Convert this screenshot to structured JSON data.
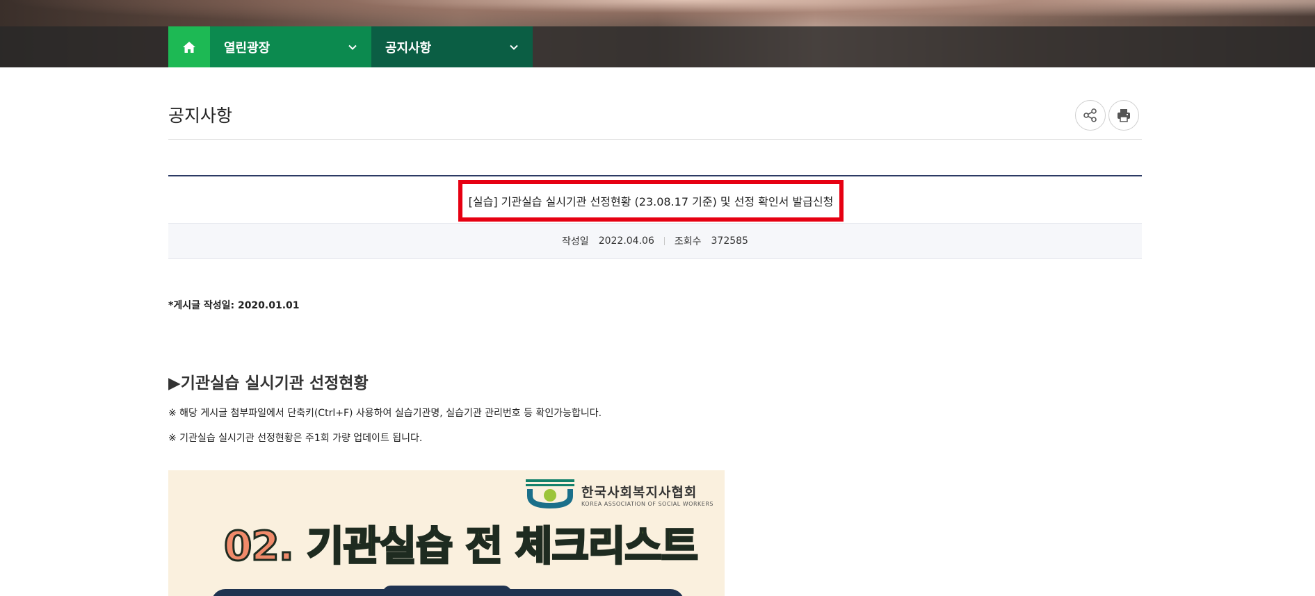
{
  "breadcrumb": {
    "home_icon": "home-icon",
    "level1": "열린광장",
    "level2": "공지사항",
    "chevron_icon": "chevron-down-icon"
  },
  "page": {
    "title": "공지사항",
    "share_icon": "share-icon",
    "print_icon": "print-icon"
  },
  "post": {
    "title": "[실습] 기관실습 실시기관 선정현황 (23.08.17 기준) 및 선정 확인서 발급신청",
    "date_label": "작성일",
    "date_value": "2022.04.06",
    "views_label": "조회수",
    "views_value": "372585"
  },
  "content": {
    "written_note": "*게시글 작성일: 2020.01.01",
    "section_heading": "▶기관실습 실시기관 선정현황",
    "note1": "※ 해당 게시글 첨부파일에서 단축키(Ctrl+F) 사용하여 실습기관명, 실습기관 관리번호 등 확인가능합니다.",
    "note2": "※ 기관실습 실시기관 선정현황은 주1회 가량 업데이트 됩니다."
  },
  "banner": {
    "logo_ko": "한국사회복지사협회",
    "logo_en": "KOREA ASSOCIATION OF SOCIAL WORKERS",
    "title_number": "02.",
    "title_text": "기관실습 전 체크리스트"
  },
  "colors": {
    "home_green": "#1db954",
    "crumb1": "#0c8a4f",
    "crumb2": "#0b5e44",
    "highlight": "#e60012",
    "post_line": "#2c3a64"
  }
}
